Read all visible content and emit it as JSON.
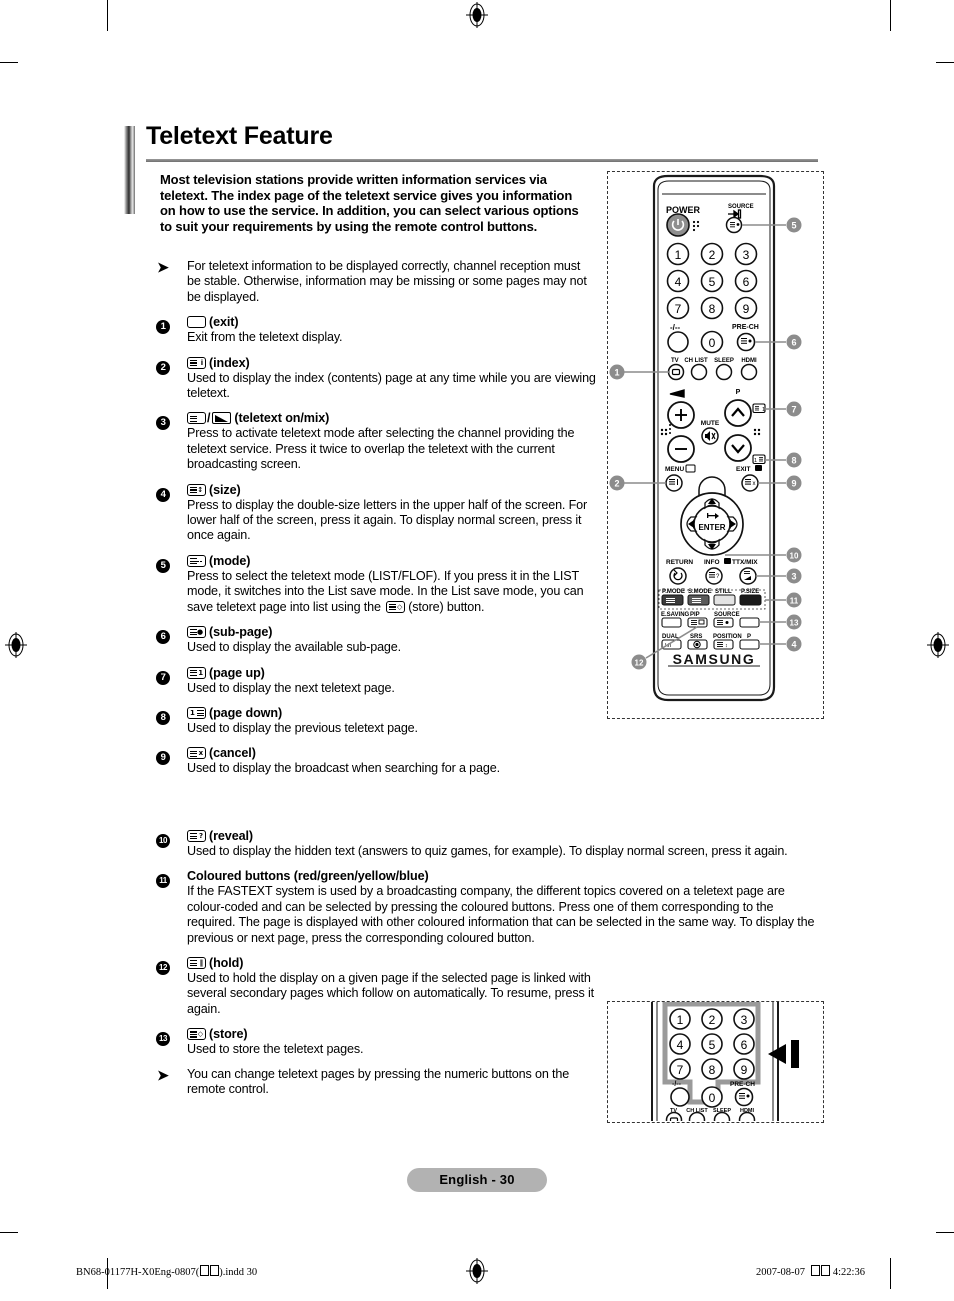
{
  "document": {
    "title": "Teletext Feature",
    "page_label": "English - 30",
    "slug_file": "BN68-01177H-X0Eng-0807(",
    "slug_file_tail": ").indd   30",
    "slug_date": "2007-08-07",
    "slug_time": "4:22:36",
    "intro": "Most television stations provide written information services via teletext. The index page of the teletext service gives you information on how to use the service. In addition, you can select various options to suit your requirements by using the remote control buttons."
  },
  "notes": {
    "top": "For teletext information to be displayed correctly, channel reception must be stable. Otherwise, information may be missing or some pages may not be displayed.",
    "bottom": "You can change teletext pages by pressing the numeric buttons on the remote control."
  },
  "items": [
    {
      "number": "1",
      "icon": "exit-key-icon",
      "label": "(exit)",
      "desc": "Exit from the teletext display."
    },
    {
      "number": "2",
      "icon": "index-key-icon",
      "label": "(index)",
      "desc": "Used to display the index (contents) page at any time while you are viewing teletext."
    },
    {
      "number": "3",
      "icon": "teletext-on-mix-key-icon",
      "label": "(teletext on/mix)",
      "desc": "Press to activate teletext mode after selecting the channel providing the teletext service. Press it twice to overlap the teletext with the current broadcasting screen."
    },
    {
      "number": "4",
      "icon": "size-key-icon",
      "label": "(size)",
      "desc": "Press to display the double-size letters in the upper half of the screen. For lower half of the screen, press it again. To display normal screen, press it once again."
    },
    {
      "number": "5",
      "icon": "mode-key-icon",
      "label": "(mode)",
      "desc_part1": "Press to select the teletext mode (LIST/FLOF). If you press it in the LIST mode, it switches into the List save mode. In the List save mode, you can save teletext page into list using the",
      "desc_part2": "(store) button."
    },
    {
      "number": "6",
      "icon": "sub-page-key-icon",
      "label": "(sub-page)",
      "desc": "Used to display the available sub-page."
    },
    {
      "number": "7",
      "icon": "page-up-key-icon",
      "label": "(page up)",
      "desc": "Used to display the next teletext page."
    },
    {
      "number": "8",
      "icon": "page-down-key-icon",
      "label": "(page down)",
      "desc": "Used to display the previous teletext page."
    },
    {
      "number": "9",
      "icon": "cancel-key-icon",
      "label": "(cancel)",
      "desc": "Used to display the broadcast when searching for a page."
    },
    {
      "number": "10",
      "icon": "reveal-key-icon",
      "label": "(reveal)",
      "desc": "Used to display the hidden text (answers to quiz games, for example). To display normal screen, press it again."
    },
    {
      "number": "11",
      "icon": "",
      "label": "Coloured buttons (red/green/yellow/blue)",
      "desc": "If the FASTEXT system is used by a broadcasting company, the different topics covered on a teletext page are colour-coded and can be selected by pressing the coloured buttons. Press one of them corresponding to the required. The page is displayed with other coloured information that can be selected in the same way. To display the previous or next page, press the corresponding coloured button."
    },
    {
      "number": "12",
      "icon": "hold-key-icon",
      "label": "(hold)",
      "desc": "Used to hold the display on a given page if the selected page is linked with several secondary pages which follow on automatically. To resume, press it again."
    },
    {
      "number": "13",
      "icon": "store-key-icon",
      "label": "(store)",
      "desc": "Used to store the teletext pages."
    }
  ],
  "remote": {
    "brand": "SAMSUNG",
    "labels": {
      "power": "POWER",
      "source": "SOURCE",
      "pre_ch": "PRE-CH",
      "minus_dash": "-/--",
      "tv": "TV",
      "ch_list": "CH LIST",
      "sleep": "SLEEP",
      "hdmi": "HDMI",
      "mute": "MUTE",
      "p": "P",
      "menu": "MENU",
      "exit": "EXIT",
      "enter": "ENTER",
      "return": "RETURN",
      "info": "INFO",
      "ttx_mix": "TTX/MIX",
      "p_mode": "P.MODE",
      "s_mode": "S.MODE",
      "still": "STILL",
      "p_size": "P.SIZE",
      "e_saving": "E.SAVING",
      "pip": "PIP",
      "dual": "DUAL",
      "srs": "SRS",
      "position": "POSITION"
    },
    "keypad": [
      "1",
      "2",
      "3",
      "4",
      "5",
      "6",
      "7",
      "8",
      "9",
      "0"
    ],
    "callouts_right": [
      "5",
      "6",
      "7",
      "8",
      "9",
      "10",
      "3",
      "11",
      "13",
      "4"
    ],
    "callouts_left": [
      "1",
      "2",
      "12"
    ]
  },
  "colors": {
    "accent_gray": "#b2b2b2",
    "callout_gray": "#8c8c8c",
    "rule_gray": "#7a7a7a"
  }
}
